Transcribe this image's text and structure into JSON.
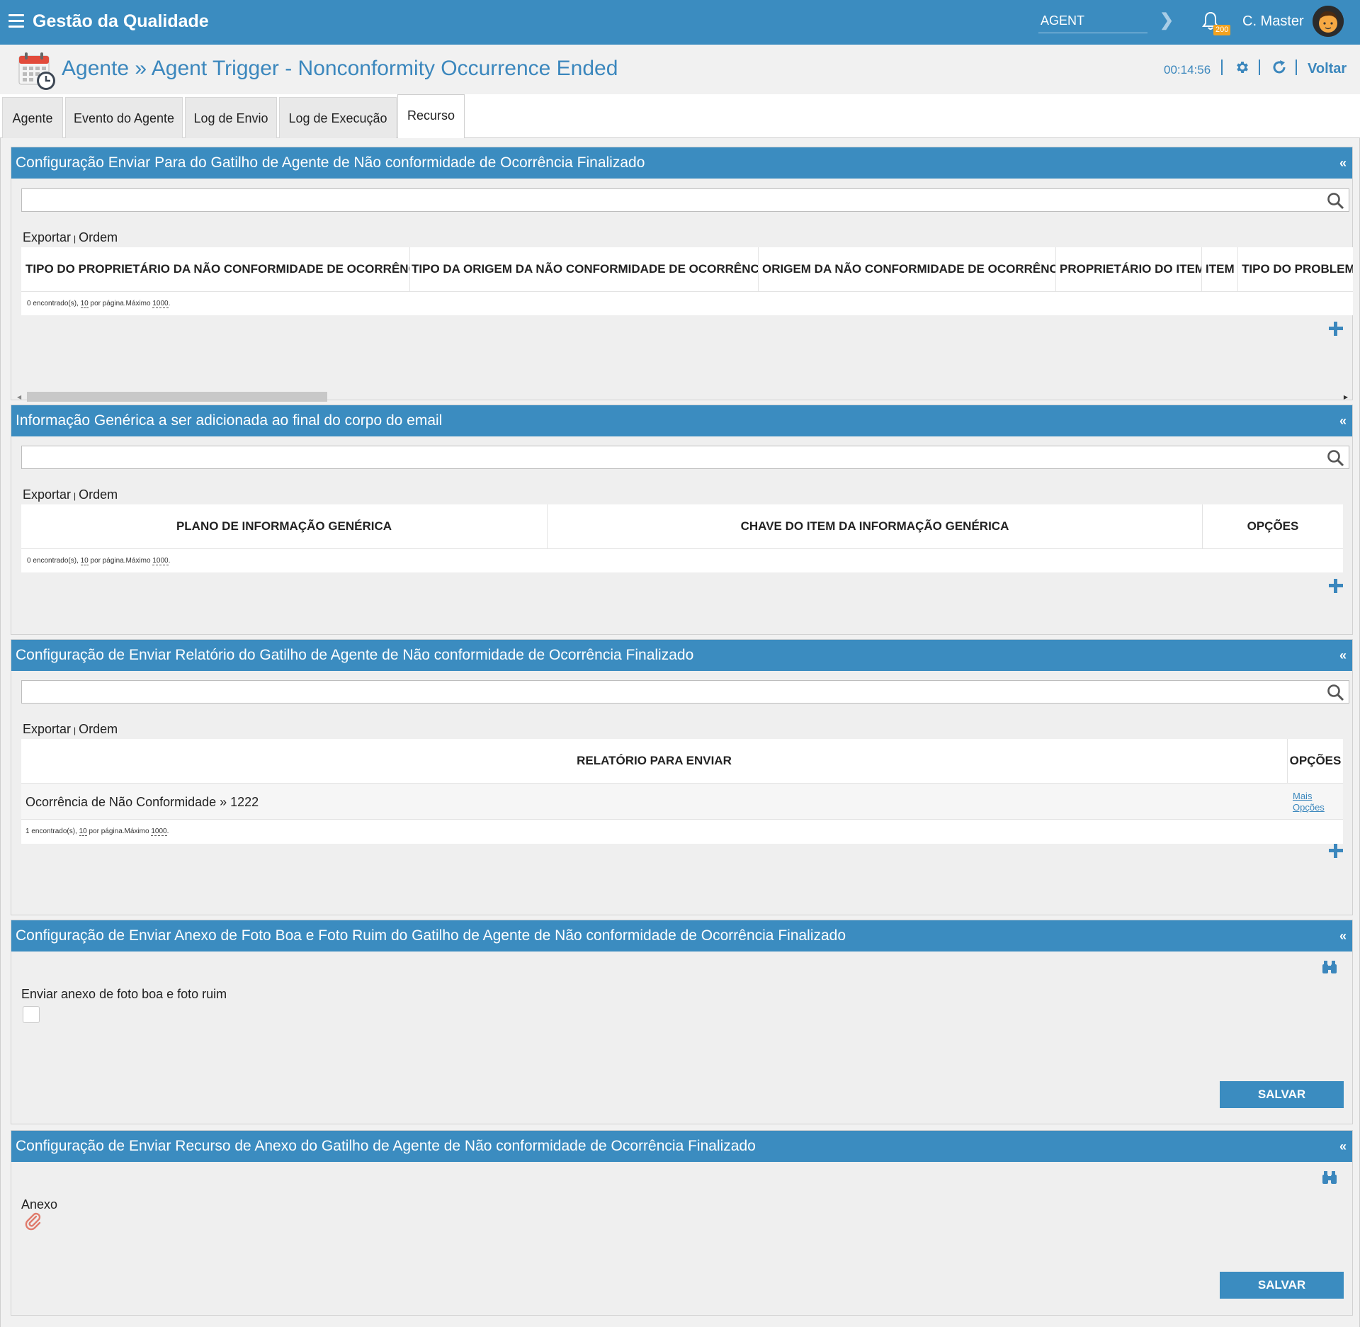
{
  "topbar": {
    "app_title": "Gestão da Qualidade",
    "module_value": "AGENT",
    "notification_count": "200",
    "user_name": "C. Master"
  },
  "header": {
    "breadcrumb": "Agente » Agent Trigger - Nonconformity Occurrence Ended",
    "timer": "00:14:56",
    "back_label": "Voltar"
  },
  "tabs": [
    "Agente",
    "Evento do Agente",
    "Log de Envio",
    "Log de Execução",
    "Recurso"
  ],
  "active_tab": "Recurso",
  "common": {
    "export_label": "Exportar",
    "order_label": "Ordem",
    "separator": "|",
    "per_page": "10",
    "per_page_text": "por página.Máximo",
    "max": "1000",
    "save_label": "SALVAR",
    "collapse": "«"
  },
  "panel1": {
    "title": "Configuração Enviar Para do Gatilho de Agente de Não conformidade de Ocorrência Finalizado",
    "columns": [
      "TIPO DO PROPRIETÁRIO DA NÃO CONFORMIDADE DE OCORRÊNCIA",
      "TIPO DA ORIGEM DA NÃO CONFORMIDADE DE OCORRÊNCIA",
      "ORIGEM DA NÃO CONFORMIDADE DE OCORRÊNCIA",
      "PROPRIETÁRIO DO ITEM",
      "ITEM",
      "TIPO DO PROBLEMA"
    ],
    "found_text": "0 encontrado(s),"
  },
  "panel2": {
    "title": "Informação Genérica a ser adicionada ao final do corpo do email",
    "columns": [
      "PLANO DE INFORMAÇÃO GENÉRICA",
      "CHAVE DO ITEM DA INFORMAÇÃO GENÉRICA",
      "OPÇÕES"
    ],
    "found_text": "0 encontrado(s),"
  },
  "panel3": {
    "title": "Configuração de Enviar Relatório do Gatilho de Agente de Não conformidade de Ocorrência Finalizado",
    "columns": [
      "RELATÓRIO PARA ENVIAR",
      "OPÇÕES"
    ],
    "rows": [
      {
        "report": "Ocorrência de Não Conformidade » 1222",
        "more_1": "Mais",
        "more_2": "Opções"
      }
    ],
    "found_text": "1 encontrado(s),"
  },
  "panel4": {
    "title": "Configuração de Enviar Anexo de Foto Boa e Foto Ruim do Gatilho de Agente de Não conformidade de Ocorrência Finalizado",
    "field_label": "Enviar anexo de foto boa e foto ruim",
    "checked": false
  },
  "panel5": {
    "title": "Configuração de Enviar Recurso de Anexo do Gatilho de Agente de Não conformidade de Ocorrência Finalizado",
    "field_label": "Anexo"
  },
  "colors": {
    "brand": "#3b8cc0",
    "link": "#3b87bd",
    "badge": "#f2a21f"
  },
  "icons": [
    "menu-icon",
    "chevron-right-icon",
    "bell-icon",
    "calendar-clock-icon",
    "gear-icon",
    "refresh-icon",
    "search-icon",
    "plus-icon",
    "binoculars-icon",
    "paperclip-icon"
  ]
}
